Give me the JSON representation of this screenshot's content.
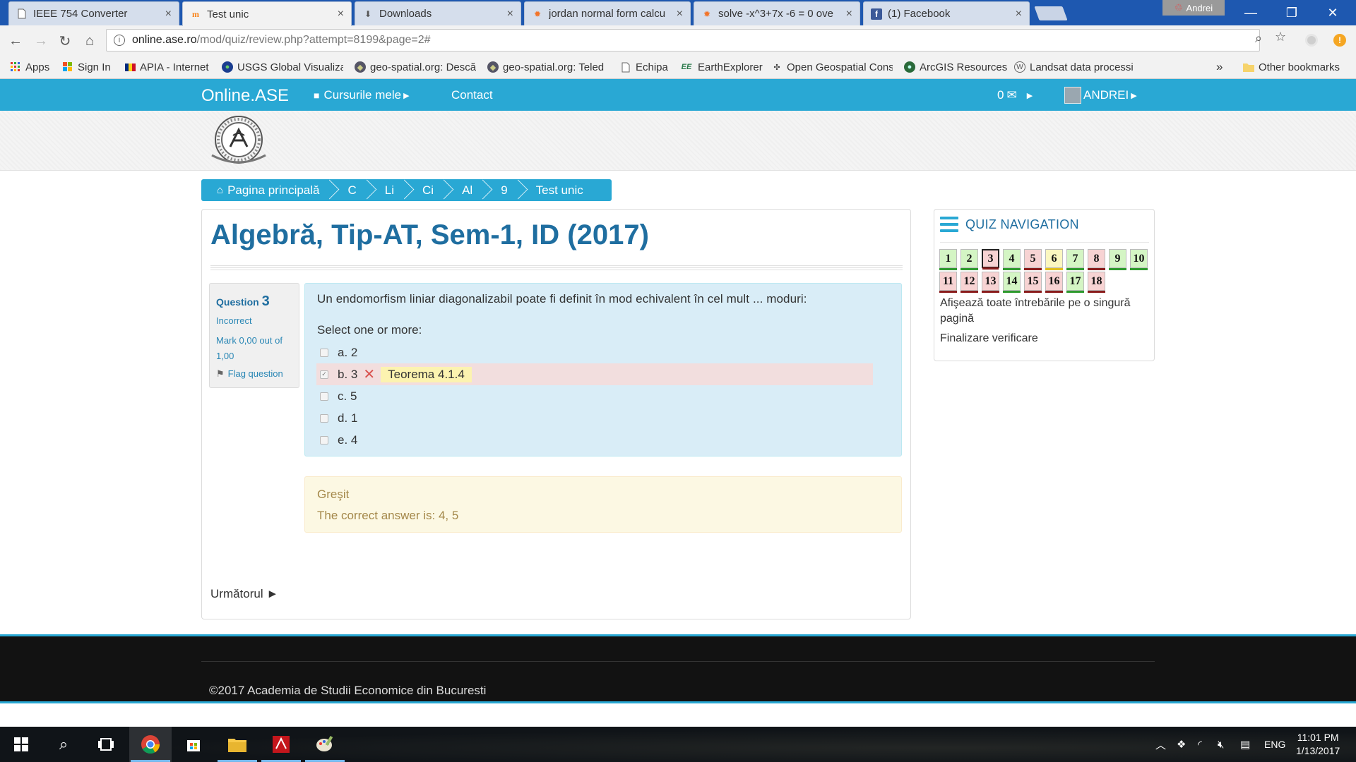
{
  "browser": {
    "tabs": [
      {
        "title": "IEEE 754 Converter",
        "icon": "page-icon",
        "active": false
      },
      {
        "title": "Test unic",
        "icon": "moodle-icon",
        "active": true
      },
      {
        "title": "Downloads",
        "icon": "download-icon",
        "active": false
      },
      {
        "title": "jordan normal form calcu",
        "icon": "wolfram-icon",
        "active": false
      },
      {
        "title": "solve -x^3+7x -6 = 0 ove",
        "icon": "wolfram-icon",
        "active": false
      },
      {
        "title": "(1) Facebook",
        "icon": "facebook-icon",
        "active": false
      }
    ],
    "tab_close": "×",
    "profile_name": "Andrei",
    "window_controls": {
      "minimize": "—",
      "restore": "❐",
      "close": "✕"
    },
    "url_host": "online.ase.ro",
    "url_path": "/mod/quiz/review.php?attempt=8199&page=2#",
    "bookmarks": [
      {
        "label": "Apps",
        "icon": "apps-grid-icon"
      },
      {
        "label": "Sign In",
        "icon": "windows-icon"
      },
      {
        "label": "APIA - Internet",
        "icon": "flag-icon"
      },
      {
        "label": "USGS Global Visualiza",
        "icon": "globe-icon"
      },
      {
        "label": "geo-spatial.org: Descă",
        "icon": "geo-icon"
      },
      {
        "label": "geo-spatial.org: Teled",
        "icon": "geo-icon"
      },
      {
        "label": "Echipa",
        "icon": "page-icon"
      },
      {
        "label": "EarthExplorer",
        "icon": "ee-icon"
      },
      {
        "label": "Open Geospatial Cons",
        "icon": "ogc-icon"
      },
      {
        "label": "ArcGIS Resources",
        "icon": "arcgis-icon"
      },
      {
        "label": "Landsat data processi",
        "icon": "wordpress-icon"
      }
    ],
    "bookmarks_overflow": "»",
    "other_bookmarks": "Other bookmarks"
  },
  "site": {
    "brand": "Online.ASE",
    "courses_label": "Cursurile mele",
    "contact_label": "Contact",
    "messages_count": "0",
    "user_name": "ANDREI"
  },
  "breadcrumb": [
    "Pagina principală",
    "C",
    "Li",
    "Ci",
    "Al",
    "9",
    "Test unic"
  ],
  "page_title": "Algebră, Tip-AT, Sem-1, ID (2017)",
  "question": {
    "label": "Question",
    "number": "3",
    "state": "Incorrect",
    "mark": "Mark 0,00 out of 1,00",
    "flag_label": "Flag question",
    "text": "Un endomorfism liniar diagonalizabil poate fi definit în mod echivalent în cel mult ... moduri:",
    "prompt": "Select one or more:",
    "answers": [
      {
        "label": "a. 2",
        "checked": false,
        "incorrect": false
      },
      {
        "label": "b. 3",
        "checked": true,
        "incorrect": true,
        "feedback": "Teorema 4.1.4"
      },
      {
        "label": "c. 5",
        "checked": false,
        "incorrect": false
      },
      {
        "label": "d. 1",
        "checked": false,
        "incorrect": false
      },
      {
        "label": "e. 4",
        "checked": false,
        "incorrect": false
      }
    ]
  },
  "outcome": {
    "general": "Greşit",
    "right_answer": "The correct answer is: 4, 5"
  },
  "next_label": "Următorul ►",
  "quiz_nav": {
    "title": "QUIZ NAVIGATION",
    "questions": [
      {
        "n": "1",
        "state": "correct"
      },
      {
        "n": "2",
        "state": "correct"
      },
      {
        "n": "3",
        "state": "wrong",
        "current": true
      },
      {
        "n": "4",
        "state": "correct"
      },
      {
        "n": "5",
        "state": "wrong"
      },
      {
        "n": "6",
        "state": "partial"
      },
      {
        "n": "7",
        "state": "correct"
      },
      {
        "n": "8",
        "state": "wrong"
      },
      {
        "n": "9",
        "state": "correct"
      },
      {
        "n": "10",
        "state": "correct"
      },
      {
        "n": "11",
        "state": "wrong"
      },
      {
        "n": "12",
        "state": "wrong"
      },
      {
        "n": "13",
        "state": "wrong"
      },
      {
        "n": "14",
        "state": "correct"
      },
      {
        "n": "15",
        "state": "wrong"
      },
      {
        "n": "16",
        "state": "wrong"
      },
      {
        "n": "17",
        "state": "correct"
      },
      {
        "n": "18",
        "state": "wrong"
      }
    ],
    "show_all": "Afişează toate întrebările pe o singură pagină",
    "finish": "Finalizare verificare"
  },
  "footer": "©2017 Academia de Studii Economice din Bucuresti",
  "taskbar": {
    "language": "ENG",
    "time": "11:01 PM",
    "date": "1/13/2017"
  },
  "colors": {
    "brand_blue": "#29a8d4",
    "title_blue": "#1f6ea0",
    "question_bg": "#d9edf7",
    "incorrect_bg": "#f2dede",
    "outcome_bg": "#fcf8e3"
  }
}
